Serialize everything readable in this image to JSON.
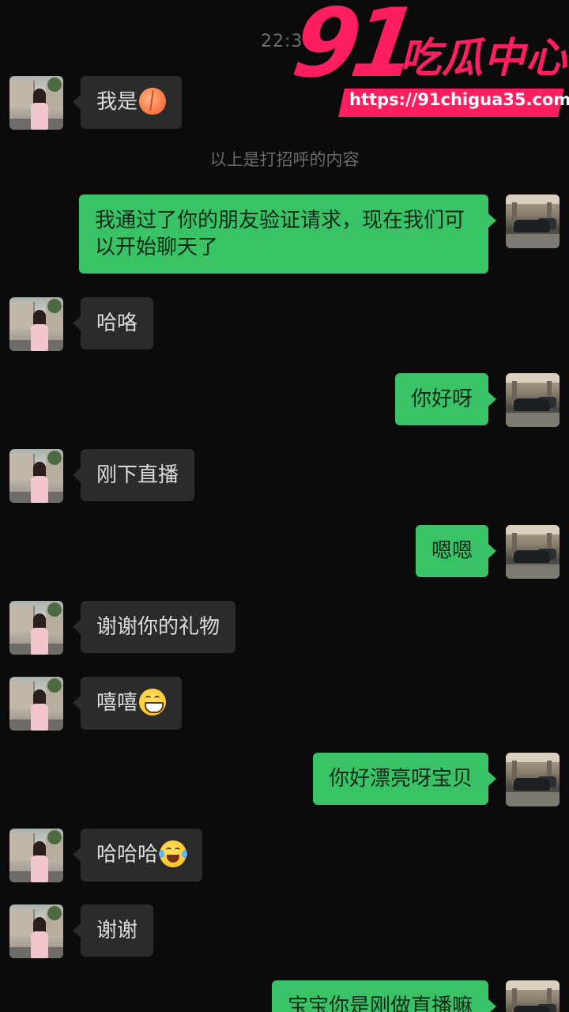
{
  "header": {
    "timestamp": "22:3"
  },
  "watermark": {
    "logo_number": "91",
    "logo_text": "吃瓜中心",
    "url": "https://91chigua35.com",
    "color": "#ff1f60"
  },
  "system_note": "以上是打招呼的内容",
  "colors": {
    "background": "#0b0b0b",
    "incoming_bubble": "#2b2b2b",
    "outgoing_bubble": "#3ac266"
  },
  "messages": [
    {
      "side": "left",
      "text": "我是",
      "emoji": "peach-emoji"
    },
    {
      "side": "right",
      "text": "我通过了你的朋友验证请求，现在我们可以开始聊天了"
    },
    {
      "side": "left",
      "text": "哈咯"
    },
    {
      "side": "right",
      "text": "你好呀"
    },
    {
      "side": "left",
      "text": "刚下直播"
    },
    {
      "side": "right",
      "text": "嗯嗯"
    },
    {
      "side": "left",
      "text": "谢谢你的礼物"
    },
    {
      "side": "left",
      "text": "嘻嘻",
      "emoji": "grin-emoji"
    },
    {
      "side": "right",
      "text": "你好漂亮呀宝贝"
    },
    {
      "side": "left",
      "text": "哈哈哈",
      "emoji": "tears-of-joy-emoji"
    },
    {
      "side": "left",
      "text": "谢谢"
    },
    {
      "side": "right",
      "text": "宝宝你是刚做直播嘛"
    }
  ]
}
